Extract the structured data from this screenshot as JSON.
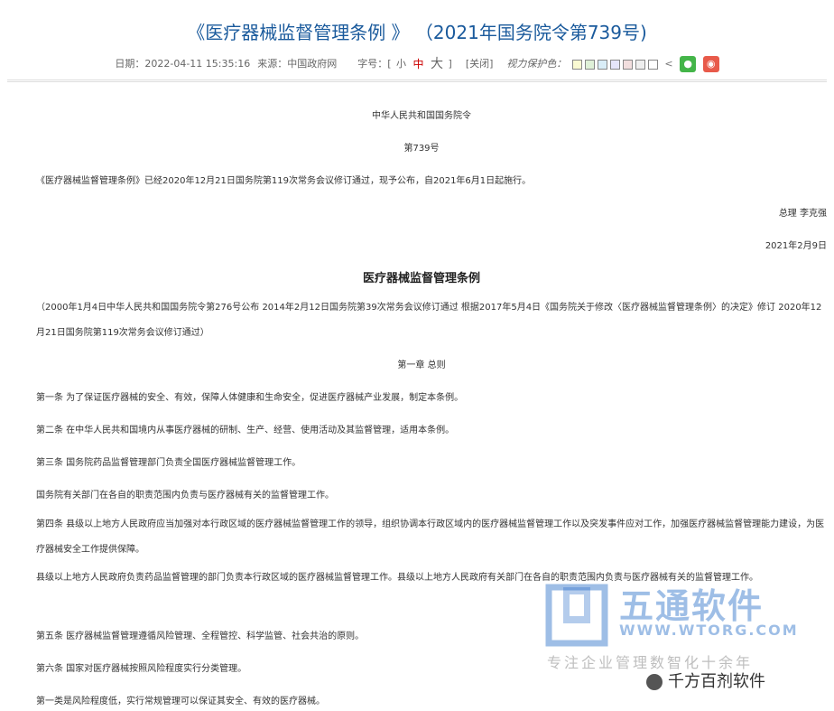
{
  "article": {
    "title": "《医疗器械监督管理条例 》 （2021年国务院令第739号)",
    "meta": {
      "date_label": "日期：",
      "date": "2022-04-11 15:35:16",
      "source_label": "来源：",
      "source": "中国政府网",
      "font_size_label": "字号：[",
      "font_small": "小",
      "font_mid": "中",
      "font_big": "大",
      "font_close_bracket": "]",
      "close_label": "[关闭]",
      "eye_protect_label": "视力保护色：",
      "swatch_colors": [
        "#fafad2",
        "#dff0d8",
        "#d9edf7",
        "#e6e6fa",
        "#f2dede",
        "#eeeeee",
        "#ffffff"
      ]
    },
    "paragraphs": {
      "issuer": "中华人民共和国国务院令",
      "order_no": "第739号",
      "announce": "《医疗器械监督管理条例》已经2020年12月21日国务院第119次常务会议修订通过，现予公布，自2021年6月1日起施行。",
      "premier": "总理  李克强",
      "sign_date": "2021年2月9日",
      "reg_title": "医疗器械监督管理条例",
      "history": "（2000年1月4日中华人民共和国国务院令第276号公布  2014年2月12日国务院第39次常务会议修订通过  根据2017年5月4日《国务院关于修改〈医疗器械监督管理条例〉的决定》修订  2020年12月21日国务院第119次常务会议修订通过）",
      "chapter1": "第一章  总则",
      "art1": "第一条   为了保证医疗器械的安全、有效，保障人体健康和生命安全，促进医疗器械产业发展，制定本条例。",
      "art2": "第二条   在中华人民共和国境内从事医疗器械的研制、生产、经营、使用活动及其监督管理，适用本条例。",
      "art3": "第三条   国务院药品监督管理部门负责全国医疗器械监督管理工作。",
      "art3b": "国务院有关部门在各自的职责范围内负责与医疗器械有关的监督管理工作。",
      "art4": "第四条   县级以上地方人民政府应当加强对本行政区域的医疗器械监督管理工作的领导，组织协调本行政区域内的医疗器械监督管理工作以及突发事件应对工作，加强医疗器械监督管理能力建设，为医疗器械安全工作提供保障。",
      "art4b": "县级以上地方人民政府负责药品监督管理的部门负责本行政区域的医疗器械监督管理工作。县级以上地方人民政府有关部门在各自的职责范围内负责与医疗器械有关的监督管理工作。",
      "art5": "第五条   医疗器械监督管理遵循风险管理、全程管控、科学监管、社会共治的原则。",
      "art6": "第六条   国家对医疗器械按照风险程度实行分类管理。",
      "art6b": "第一类是风险程度低，实行常规管理可以保证其安全、有效的医疗器械。"
    }
  },
  "watermark": {
    "name": "五通软件",
    "url": "WWW.WTORG.COM",
    "slogan": "专注企业管理数智化十余年",
    "account": "千方百剂软件"
  }
}
